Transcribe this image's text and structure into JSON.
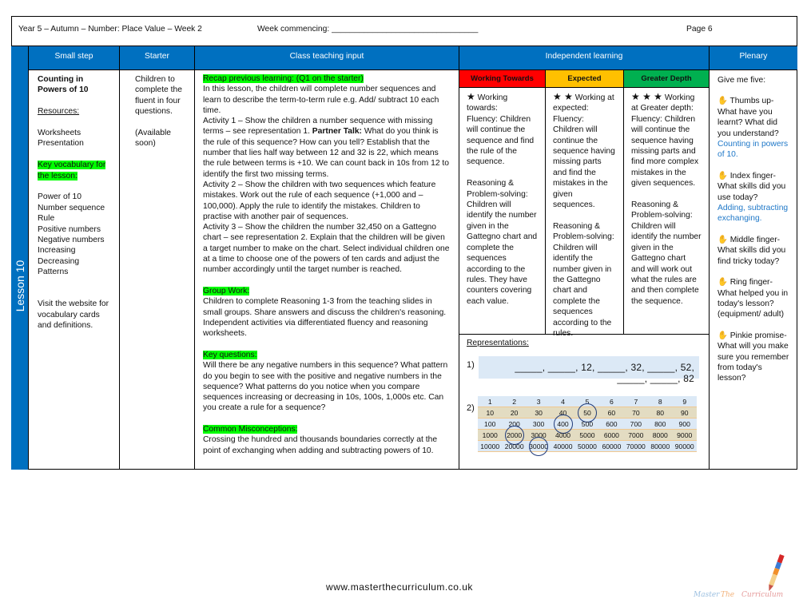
{
  "header": {
    "title": "Year 5 – Autumn – Number: Place Value – Week 2",
    "week": "Week commencing: ________________________________",
    "page": "Page 6"
  },
  "lesson_label": "Lesson 10",
  "columns": {
    "small_step": "Small step",
    "starter": "Starter",
    "class_teaching": "Class teaching input",
    "independent": "Independent learning",
    "plenary": "Plenary"
  },
  "small_step": {
    "title": "Counting in Powers of 10",
    "resources_label": "Resources:",
    "resources": "Worksheets\nPresentation",
    "vocab_label": "Key vocabulary for the lesson:",
    "vocab": "Power of 10\nNumber sequence\nRule\nPositive numbers\nNegative numbers\nIncreasing\nDecreasing\nPatterns",
    "website": "Visit the website for vocabulary cards and definitions."
  },
  "starter": {
    "text": "Children to complete the fluent in four questions.",
    "note": "(Available soon)"
  },
  "teaching": {
    "recap_label": "Recap previous learning: (Q1 on the starter)",
    "intro": "In this lesson, the children will complete number sequences and learn to describe the term-to-term rule e.g. Add/ subtract 10 each time.",
    "a1_pre": "Activity 1 – Show the children a number sequence with missing terms – see representation 1. ",
    "a1_bold": "Partner Talk:",
    "a1_post": " What do you think is the rule of this sequence? How can you tell?  Establish that the number that lies half way between 12 and 32 is 22, which means the rule between terms is +10. We can count  back in 10s from 12 to identify the first two missing terms.",
    "a2": "Activity 2 – Show the children with two sequences which feature mistakes. Work out the rule of each sequence (+1,000 and – 100,000). Apply the rule to identify the mistakes. Children to practise with another pair of sequences.",
    "a3": "Activity 3 – Show the children the number 32,450 on a Gattegno chart – see representation 2.  Explain that the children will be given a target number to make on the chart. Select individual children one at a time to choose one of the powers of ten cards and adjust the number accordingly until the target number is reached.",
    "group_label": "Group Work:",
    "group": "Children to complete Reasoning 1-3 from the teaching slides in small groups. Share answers and discuss the children's reasoning. Independent activities via differentiated fluency and reasoning worksheets.",
    "key_label": "Key questions:",
    "key": "Will there be any negative numbers in this sequence? What pattern do you begin to see with the positive and negative numbers in the sequence? What patterns do you notice when you compare sequences increasing or decreasing in 10s, 100s, 1,000s etc. Can you create a rule for a sequence?",
    "mis_label": "Common Misconceptions:",
    "mis": "Crossing the hundred and thousands boundaries correctly at the point of exchanging when adding and subtracting powers of 10."
  },
  "levels": [
    {
      "label": "Working Towards",
      "color": "#ff0000",
      "stars": "★",
      "text": " Working towards:\nFluency: Children will continue the sequence and find the rule of the sequence.\n\nReasoning & Problem-solving: Children will identify the number given in the Gattegno chart and complete the sequences according to the rules. They have counters covering each value."
    },
    {
      "label": "Expected",
      "color": "#ffc000",
      "stars": "★ ★",
      "text": " Working at expected:\nFluency:\nChildren will continue the sequence having missing parts and find the mistakes in the given sequences.\n\nReasoning & Problem-solving: Children will identify the number given in the Gattegno chart and complete the sequences according to the rules."
    },
    {
      "label": "Greater Depth",
      "color": "#00b050",
      "stars": "★ ★ ★",
      "text": " Working at Greater depth:\nFluency: Children will continue the sequence having missing parts and find more complex mistakes in the given sequences.\n\nReasoning & Problem-solving: Children will identify the number given in the Gattegno chart and will work out what the rules are and then complete the sequence."
    }
  ],
  "representations": {
    "label": "Representations:",
    "r1_label": "1)",
    "sequence": "_____, _____, 12, _____, 32, _____, 52, _____, _____, 82",
    "r2_label": "2)",
    "gattegno": [
      [
        "1",
        "2",
        "3",
        "4",
        "5",
        "6",
        "7",
        "8",
        "9"
      ],
      [
        "10",
        "20",
        "30",
        "40",
        "50",
        "60",
        "70",
        "80",
        "90"
      ],
      [
        "100",
        "200",
        "300",
        "400",
        "500",
        "600",
        "700",
        "800",
        "900"
      ],
      [
        "1000",
        "2000",
        "3000",
        "4000",
        "5000",
        "6000",
        "7000",
        "8000",
        "9000"
      ],
      [
        "10000",
        "20000",
        "30000",
        "40000",
        "50000",
        "60000",
        "70000",
        "80000",
        "90000"
      ]
    ],
    "circled": [
      "50",
      "400",
      "2000",
      "30000"
    ]
  },
  "plenary": {
    "intro": "Give me five:",
    "items": [
      {
        "q": " Thumbs up- What have you learnt? What did you understand?",
        "a": "Counting in powers of 10."
      },
      {
        "q": " Index finger- What skills did you use today?",
        "a": "Adding, subtracting exchanging."
      },
      {
        "q": " Middle finger- What skills did you find tricky today?",
        "a": ""
      },
      {
        "q": " Ring finger- What helped you in today's lesson? (equipment/ adult)",
        "a": ""
      },
      {
        "q": " Pinkie promise- What will you make sure you remember from today's lesson?",
        "a": ""
      }
    ],
    "icon": "✋"
  },
  "footer": {
    "url": "www.masterthecurriculum.co.uk",
    "logo_text": "Master The Curriculum"
  },
  "colors": {
    "header_blue": "#0070c0",
    "highlight": "#00ff00",
    "answer_blue": "#1f78c8"
  }
}
